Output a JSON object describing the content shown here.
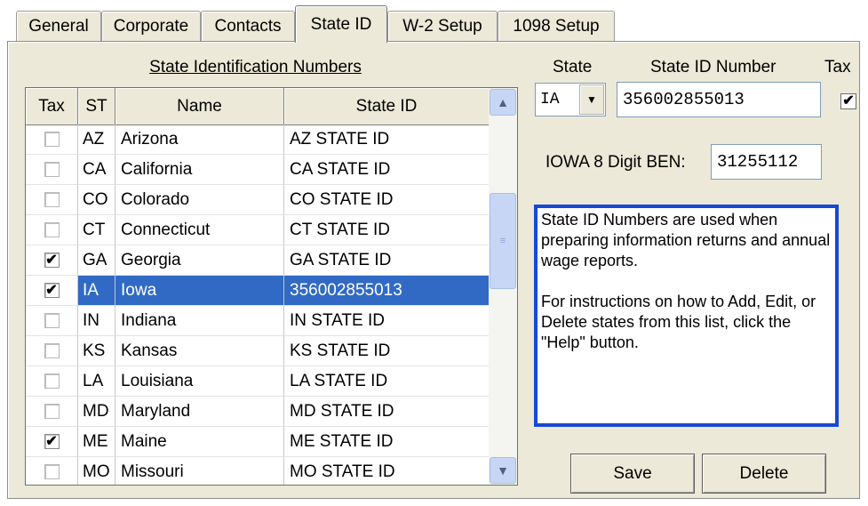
{
  "tabs": [
    {
      "label": "General"
    },
    {
      "label": "Corporate"
    },
    {
      "label": "Contacts"
    },
    {
      "label": "State ID"
    },
    {
      "label": "W-2 Setup"
    },
    {
      "label": "1098 Setup"
    }
  ],
  "grid": {
    "title": "State Identification Numbers",
    "columns": [
      "Tax",
      "ST",
      "Name",
      "State ID"
    ],
    "rows": [
      {
        "tax": false,
        "st": "AZ",
        "name": "Arizona",
        "state_id": "AZ STATE ID"
      },
      {
        "tax": false,
        "st": "CA",
        "name": "California",
        "state_id": "CA STATE ID"
      },
      {
        "tax": false,
        "st": "CO",
        "name": "Colorado",
        "state_id": "CO STATE ID"
      },
      {
        "tax": false,
        "st": "CT",
        "name": "Connecticut",
        "state_id": "CT STATE ID"
      },
      {
        "tax": true,
        "st": "GA",
        "name": "Georgia",
        "state_id": "GA STATE ID"
      },
      {
        "tax": true,
        "st": "IA",
        "name": "Iowa",
        "state_id": "356002855013",
        "selected": true
      },
      {
        "tax": false,
        "st": "IN",
        "name": "Indiana",
        "state_id": "IN STATE ID"
      },
      {
        "tax": false,
        "st": "KS",
        "name": "Kansas",
        "state_id": "KS STATE ID"
      },
      {
        "tax": false,
        "st": "LA",
        "name": "Louisiana",
        "state_id": "LA STATE ID"
      },
      {
        "tax": false,
        "st": "MD",
        "name": "Maryland",
        "state_id": "MD STATE ID"
      },
      {
        "tax": true,
        "st": "ME",
        "name": "Maine",
        "state_id": "ME STATE ID"
      },
      {
        "tax": false,
        "st": "MO",
        "name": "Missouri",
        "state_id": "MO STATE ID"
      }
    ]
  },
  "detail": {
    "state_label": "State",
    "state_id_label": "State ID Number",
    "tax_label": "Tax",
    "state_value": "IA",
    "state_id_value": "356002855013",
    "tax_checked": true,
    "ben_label": "IOWA 8 Digit BEN:",
    "ben_value": "31255112"
  },
  "info": {
    "para1": "State ID Numbers are used when preparing information returns and annual wage reports.",
    "para2": "For instructions on how to Add, Edit, or Delete states from this list, click the \"Help\" button."
  },
  "buttons": {
    "save": "Save",
    "delete": "Delete"
  },
  "colors": {
    "selection": "#316ac5",
    "info_border": "#1549d6",
    "panel": "#ece9d8"
  }
}
